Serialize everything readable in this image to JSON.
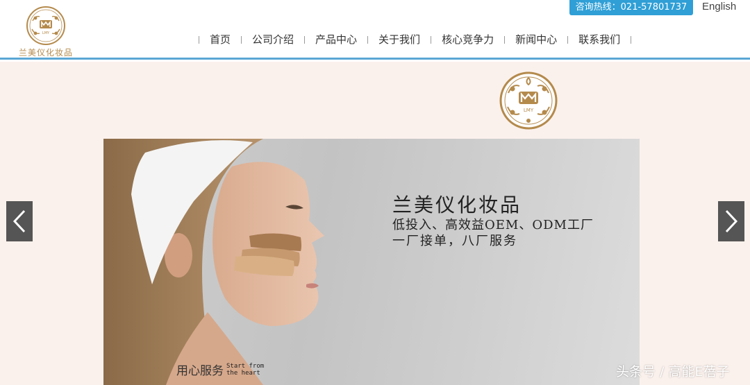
{
  "brand": {
    "logo_text": "兰美仪化妆品",
    "logo_mark": "LMY",
    "gold": "#b48a4c"
  },
  "header": {
    "hotline": "咨询热线：021-57801737",
    "language": "English",
    "accent": "#5aa7d4"
  },
  "nav": {
    "items": [
      "首页",
      "公司介绍",
      "产品中心",
      "关于我们",
      "核心竞争力",
      "新闻中心",
      "联系我们"
    ]
  },
  "banner": {
    "title": "兰美仪化妆品",
    "line1": "低投入、高效益OEM、ODM工厂",
    "line2": "一厂接单，八厂服务",
    "slogan_cn": "用心服务",
    "slogan_en": "Start from the heart"
  },
  "slider": {
    "prev_icon": "chevron-left-icon",
    "next_icon": "chevron-right-icon"
  },
  "watermark": "头条号 / 高能E蓓子"
}
